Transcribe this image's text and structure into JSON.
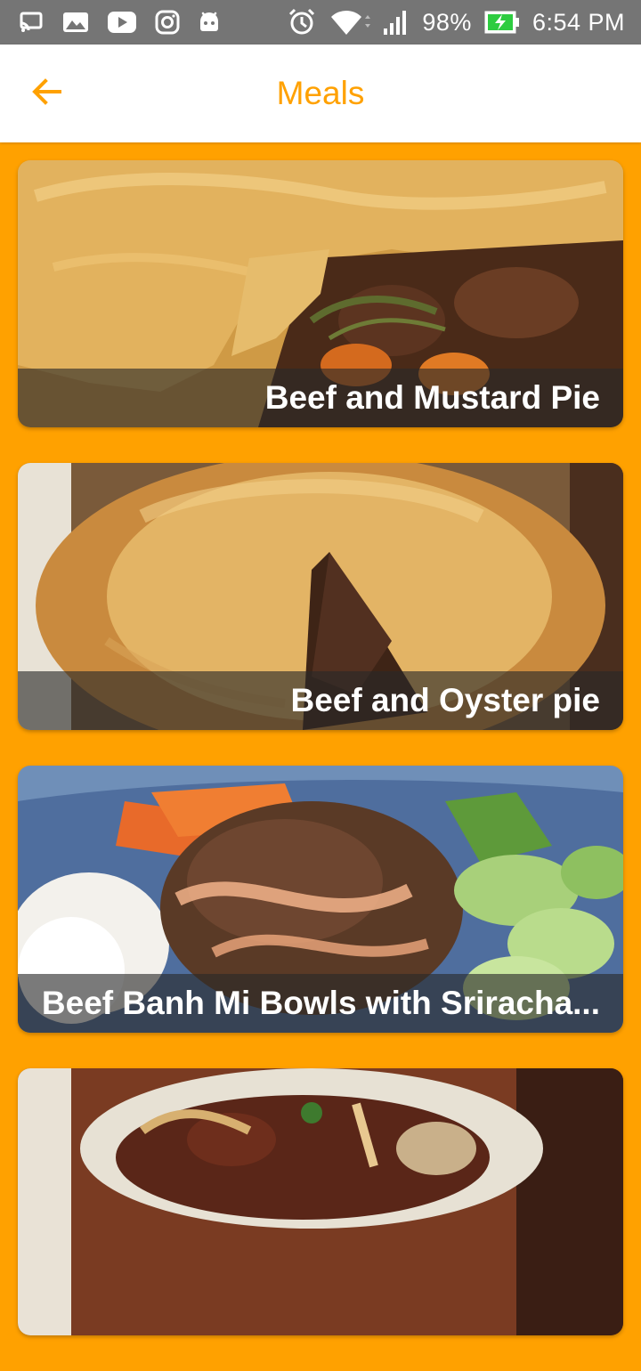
{
  "status_bar": {
    "icons_left": [
      "cast-icon",
      "gallery-icon",
      "youtube-icon",
      "instagram-icon",
      "android-icon"
    ],
    "icons_right": [
      "alarm-icon",
      "wifi-icon",
      "signal-icon",
      "battery-charging-icon"
    ],
    "battery": "98%",
    "time": "6:54 PM"
  },
  "app_bar": {
    "back_icon": "arrow-left-icon",
    "title": "Meals",
    "accent_color": "#FFA100"
  },
  "meals": [
    {
      "name": "Beef and Mustard Pie",
      "image": "meat-pie-with-thyme-and-carrots"
    },
    {
      "name": "Beef and Oyster pie",
      "image": "golden-crust-pie-slice-removed"
    },
    {
      "name": "Beef Banh Mi Bowls with Sriracha...",
      "image": "rice-bowl-with-ground-beef-carrots-cucumber"
    },
    {
      "name": "",
      "image": "beef-stew-with-mushrooms"
    }
  ]
}
